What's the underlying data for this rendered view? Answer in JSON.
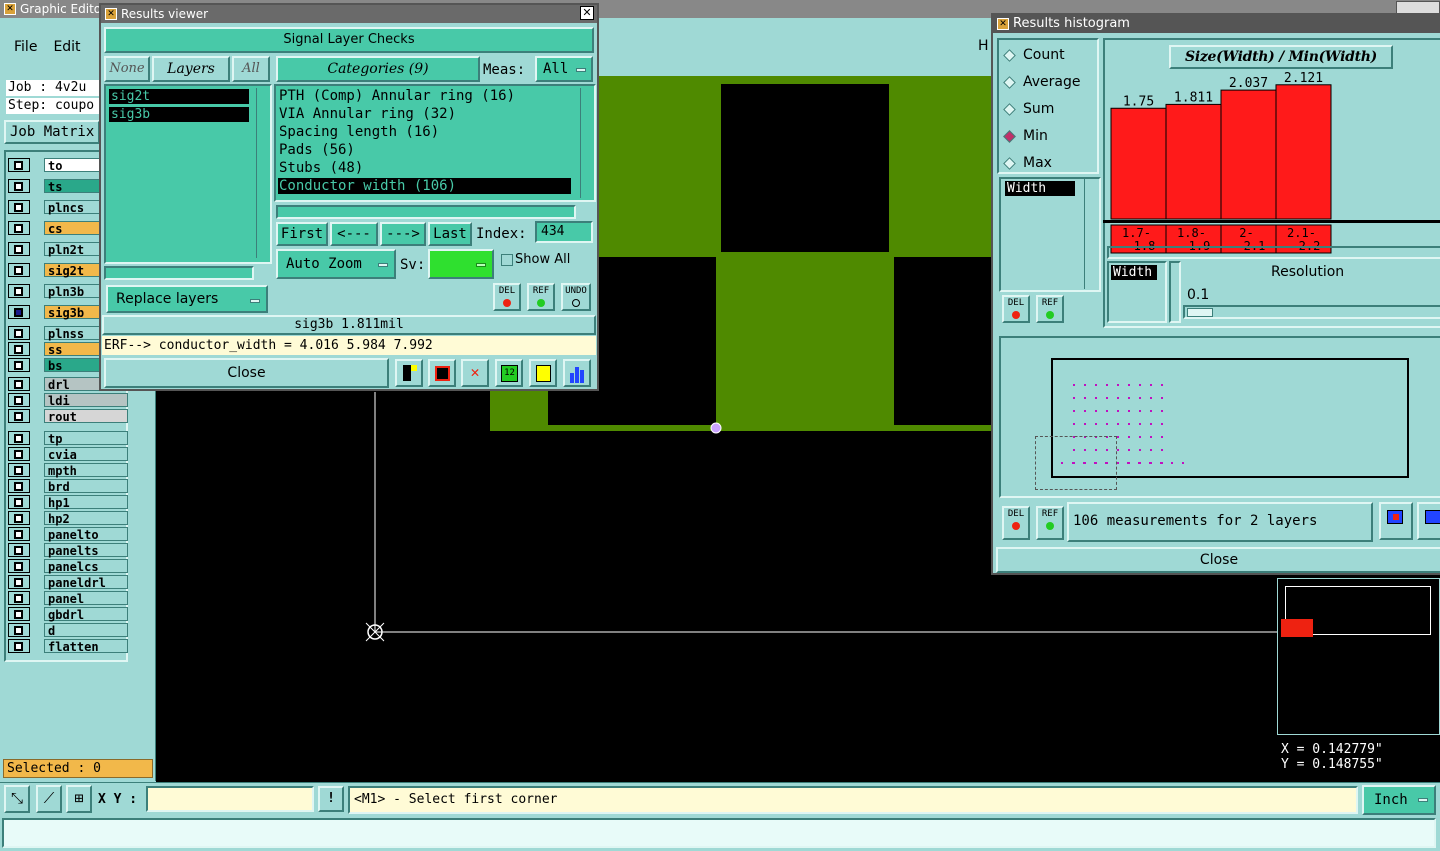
{
  "graphic_editor": {
    "title": "Graphic Editor",
    "menu": [
      "File",
      "Edit"
    ],
    "help_initial": "H",
    "job": "Job : 4v2u",
    "step": "Step: coupo",
    "job_matrix": "Job Matrix",
    "layers": [
      {
        "name": "to",
        "color": "#ffffff"
      },
      {
        "name": "ts",
        "color": "#2aa88a"
      },
      {
        "name": "plncs",
        "color": "#9fd9d5"
      },
      {
        "name": "cs",
        "color": "#f2b84a"
      },
      {
        "name": "pln2t",
        "color": "#9fd9d5"
      },
      {
        "name": "sig2t",
        "color": "#f2b84a"
      },
      {
        "name": "pln3b",
        "color": "#9fd9d5"
      },
      {
        "name": "sig3b",
        "color": "#f2b84a"
      },
      {
        "name": "plnss",
        "color": "#9fd9d5"
      },
      {
        "name": "ss",
        "color": "#f2b84a"
      },
      {
        "name": "bs",
        "color": "#2aa88a"
      },
      {
        "name": "drl",
        "color": "#b5c4c3"
      },
      {
        "name": "ldi",
        "color": "#b5c4c3"
      },
      {
        "name": "rout",
        "color": "#d6d6d6"
      },
      {
        "name": "tp",
        "color": "#9fd9d5"
      },
      {
        "name": "cvia",
        "color": "#9fd9d5"
      },
      {
        "name": "mpth",
        "color": "#9fd9d5"
      },
      {
        "name": "brd",
        "color": "#9fd9d5"
      },
      {
        "name": "hp1",
        "color": "#9fd9d5"
      },
      {
        "name": "hp2",
        "color": "#9fd9d5"
      },
      {
        "name": "panelto",
        "color": "#9fd9d5"
      },
      {
        "name": "panelts",
        "color": "#9fd9d5"
      },
      {
        "name": "panelcs",
        "color": "#9fd9d5"
      },
      {
        "name": "paneldrl",
        "color": "#9fd9d5"
      },
      {
        "name": "panel",
        "color": "#9fd9d5"
      },
      {
        "name": "gbdrl",
        "color": "#9fd9d5"
      },
      {
        "name": "d",
        "color": "#9fd9d5"
      },
      {
        "name": "flatten",
        "color": "#9fd9d5"
      }
    ],
    "selected": "Selected : 0",
    "xy_label": "X Y :",
    "prompt": "<M1> - Select first corner",
    "units": "Inch",
    "coord_x": "X = 0.142779\"",
    "coord_y": "Y = 0.148755\""
  },
  "results_viewer": {
    "title": "Results viewer",
    "header": "Signal Layer Checks",
    "none_btn": "None",
    "layers_btn": "Layers",
    "all_btn": "All",
    "layers": [
      "sig2t",
      "sig3b"
    ],
    "categories_label": "Categories (9)",
    "meas_label": "Meas:",
    "meas_value": "All",
    "categories": [
      "PTH (Comp) Annular ring (16)",
      "VIA Annular ring (32)",
      "Spacing length (16)",
      "Pads (56)",
      "Stubs (48)",
      "Conductor width (106)"
    ],
    "first": "First",
    "prev": "<---",
    "next": "--->",
    "last": "Last",
    "index_label": "Index:",
    "index_value": "434",
    "auto_zoom": "Auto Zoom",
    "sv_label": "Sv:",
    "show_all": "Show All",
    "replace_layers": "Replace layers",
    "del": "DEL",
    "ref": "REF",
    "undo": "UNDO",
    "status": "sig3b 1.811mil",
    "erf": "ERF--> conductor_width = 4.016 5.984 7.992",
    "close": "Close"
  },
  "histogram": {
    "title": "Results histogram",
    "modes": [
      "Count",
      "Average",
      "Sum",
      "Min",
      "Max"
    ],
    "selected_mode": "Min",
    "chart_title": "Size(Width) / Min(Width)",
    "width_label": "Width",
    "width_label2": "Width",
    "resolution_label": "Resolution",
    "resolution_value": "0.1",
    "bins": [
      {
        "range": "1.7- 1.8",
        "value": "1.75"
      },
      {
        "range": "1.8- 1.9",
        "value": "1.811"
      },
      {
        "range": "2- 2.1",
        "value": "2.037"
      },
      {
        "range": "2.1- 2.2",
        "value": "2.121"
      }
    ],
    "summary": "106 measurements for 2 layers",
    "del": "DEL",
    "ref": "REF",
    "close": "Close"
  },
  "chart_data": {
    "type": "bar",
    "title": "Size(Width) / Min(Width)",
    "categories": [
      "1.7- 1.8",
      "1.8- 1.9",
      "2- 2.1",
      "2.1- 2.2"
    ],
    "values": [
      1.75,
      1.811,
      2.037,
      2.121
    ]
  }
}
